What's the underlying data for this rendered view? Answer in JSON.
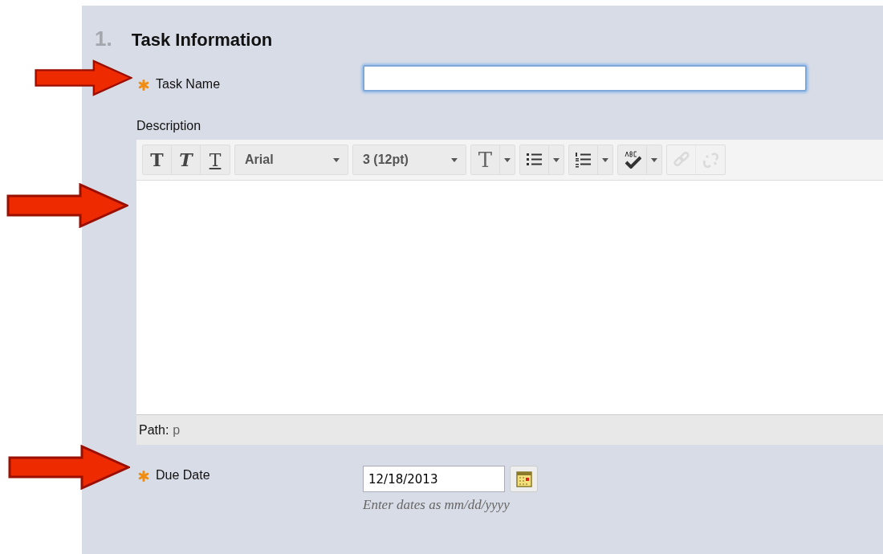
{
  "section": {
    "number": "1.",
    "title": "Task Information"
  },
  "task_name": {
    "label": "Task Name",
    "required": true,
    "focused": true,
    "arrow": true
  },
  "description": {
    "label": "Description",
    "arrow": true,
    "toolbar": [
      {
        "items": [
          {
            "kind": "bold",
            "glyph": "T",
            "disabled": false
          },
          {
            "kind": "italic",
            "glyph": "T",
            "disabled": false
          },
          {
            "kind": "underline",
            "glyph": "T",
            "disabled": false
          }
        ]
      },
      {
        "items": [
          {
            "kind": "select",
            "text": "Arial",
            "disabled": false
          }
        ]
      },
      {
        "items": [
          {
            "kind": "select",
            "text": "3 (12pt)",
            "disabled": false
          }
        ]
      },
      {
        "items": [
          {
            "kind": "color",
            "glyph": "T",
            "disabled": false
          },
          {
            "kind": "dropdown",
            "disabled": false
          }
        ]
      },
      {
        "items": [
          {
            "kind": "bullets",
            "disabled": false
          },
          {
            "kind": "dropdown",
            "disabled": false
          }
        ]
      },
      {
        "items": [
          {
            "kind": "numbers",
            "disabled": false
          },
          {
            "kind": "dropdown",
            "disabled": false
          }
        ]
      },
      {
        "items": [
          {
            "kind": "spellcheck",
            "disabled": false
          },
          {
            "kind": "dropdown",
            "disabled": false
          }
        ]
      },
      {
        "items": [
          {
            "kind": "link",
            "disabled": true
          },
          {
            "kind": "unlink",
            "disabled": true
          }
        ]
      }
    ],
    "path_label": "Path:",
    "path_value": "p"
  },
  "due_date": {
    "label": "Due Date",
    "required": true,
    "value": "12/18/2013",
    "hint": "Enter dates as mm/dd/yyyy",
    "arrow": true
  }
}
